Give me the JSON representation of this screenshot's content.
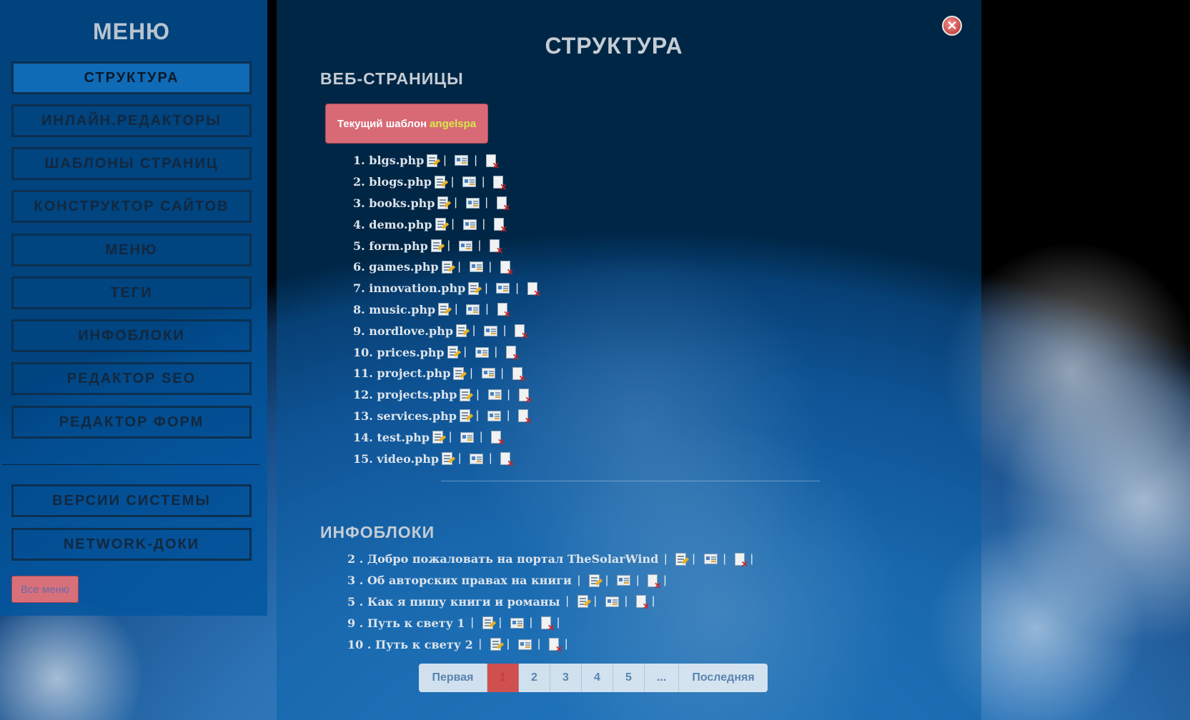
{
  "sidebar": {
    "title": "МЕНЮ",
    "items": [
      {
        "label": "СТРУКТУРА"
      },
      {
        "label": "ИНЛАЙН.РЕДАКТОРЫ"
      },
      {
        "label": "ШАБЛОНЫ СТРАНИЦ"
      },
      {
        "label": "КОНСТРУКТОР САЙТОВ"
      },
      {
        "label": "МЕНЮ"
      },
      {
        "label": "ТЕГИ"
      },
      {
        "label": "ИНФОБЛОКИ"
      },
      {
        "label": "РЕДАКТОР SEO"
      },
      {
        "label": "РЕДАКТОР ФОРМ"
      }
    ],
    "extra_items": [
      {
        "label": "ВЕРСИИ СИСТЕМЫ"
      },
      {
        "label": "NETWORK-ДОКИ"
      }
    ],
    "all_menu_label": "Все меню"
  },
  "main": {
    "close_label": "✕",
    "title": "СТРУКТУРА",
    "web_section_title": "ВЕБ-СТРАНИЦЫ",
    "template_label": "Текущий шаблон",
    "template_name": "angelspa",
    "separator": "|",
    "pages": [
      {
        "label": "1. blgs.php"
      },
      {
        "label": "2. blogs.php"
      },
      {
        "label": "3. books.php"
      },
      {
        "label": "4. demo.php"
      },
      {
        "label": "5. form.php"
      },
      {
        "label": "6. games.php"
      },
      {
        "label": "7. innovation.php"
      },
      {
        "label": "8. music.php"
      },
      {
        "label": "9. nordlove.php"
      },
      {
        "label": "10. prices.php"
      },
      {
        "label": "11. project.php"
      },
      {
        "label": "12. projects.php"
      },
      {
        "label": "13. services.php"
      },
      {
        "label": "14. test.php"
      },
      {
        "label": "15. video.php"
      }
    ],
    "infoblocks_title": "ИНФОБЛОКИ",
    "infoblocks": [
      {
        "label": "2 . Добро пожаловать на портал TheSolarWind"
      },
      {
        "label": "3 . Об авторских правах на книги"
      },
      {
        "label": "5 . Как я пишу книги и романы"
      },
      {
        "label": "9 . Путь к свету 1"
      },
      {
        "label": "10 . Путь к свету 2"
      }
    ]
  },
  "pagination": {
    "first": "Первая",
    "pages": [
      "1",
      "2",
      "3",
      "4",
      "5",
      "..."
    ],
    "current": "1",
    "last": "Последняя"
  },
  "icons": {
    "edit": "edit-page-icon",
    "view": "view-page-icon",
    "delete": "delete-page-icon"
  },
  "colors": {
    "sidebar_bg": "#00569f",
    "active_button_bg": "#0f6bb6",
    "template_button_bg": "#d86a76",
    "template_name": "#d8e84a",
    "pager_active": "#d05050"
  }
}
